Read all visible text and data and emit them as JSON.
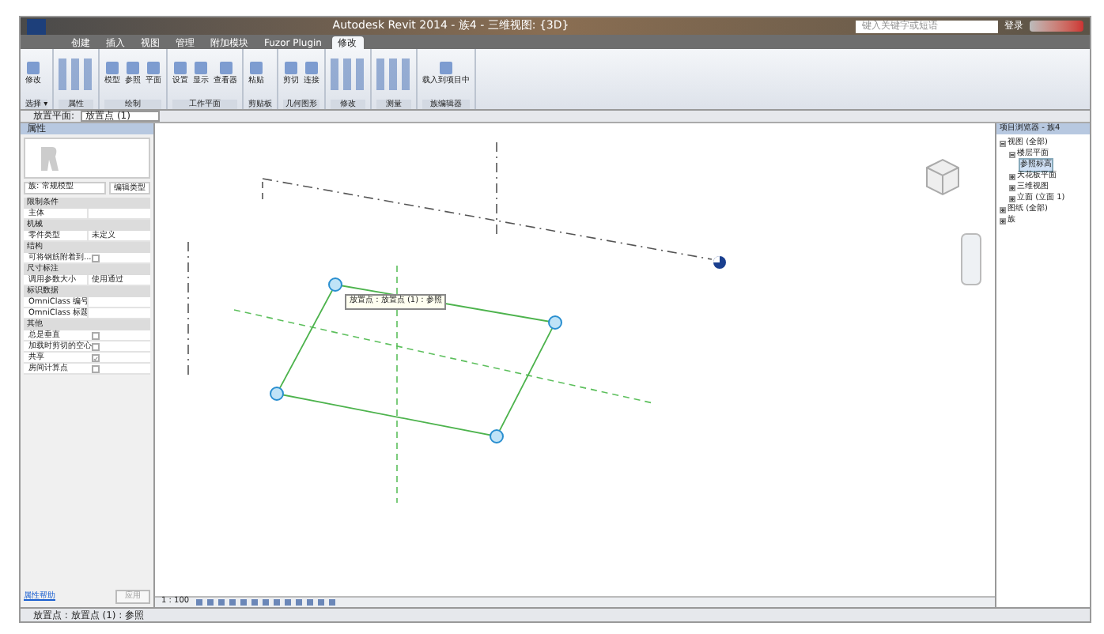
{
  "window": {
    "title": "Autodesk Revit 2014 - 族4 - 三维视图: {3D}"
  },
  "search": {
    "placeholder": "键入关键字或短语"
  },
  "sign_in": "登录",
  "tabs": [
    {
      "label": "创建",
      "selected": false
    },
    {
      "label": "插入",
      "selected": false
    },
    {
      "label": "视图",
      "selected": false
    },
    {
      "label": "管理",
      "selected": false
    },
    {
      "label": "附加模块",
      "selected": false
    },
    {
      "label": "Fuzor Plugin",
      "selected": false
    },
    {
      "label": "修改",
      "selected": true
    }
  ],
  "ribbon_panels": [
    {
      "label": "选择 ▾",
      "buttons": [
        "修改"
      ]
    },
    {
      "label": "属性"
    },
    {
      "label": "绘制",
      "buttons": [
        "模型",
        "参照",
        "平面"
      ]
    },
    {
      "label": "工作平面",
      "buttons": [
        "设置",
        "显示",
        "查看器"
      ]
    },
    {
      "label": "剪贴板",
      "buttons": [
        "粘贴"
      ]
    },
    {
      "label": "几何图形",
      "buttons": [
        "剪切",
        "连接"
      ]
    },
    {
      "label": "修改"
    },
    {
      "label": "测量"
    },
    {
      "label": "族编辑器",
      "buttons": [
        "载入到项目中"
      ]
    }
  ],
  "options_bar": {
    "label": "放置平面:",
    "value": "放置点 (1)"
  },
  "properties": {
    "title": "属性",
    "type_selector": "族: 常规模型",
    "edit_type": "编辑类型",
    "groups": [
      {
        "name": "限制条件",
        "rows": [
          {
            "kind": "text",
            "label": "主体",
            "value": ""
          }
        ]
      },
      {
        "name": "机械",
        "rows": [
          {
            "kind": "text",
            "label": "零件类型",
            "value": "未定义"
          }
        ]
      },
      {
        "name": "结构",
        "rows": [
          {
            "kind": "check",
            "label": "可将钢筋附着到...",
            "checked": false
          }
        ]
      },
      {
        "name": "尺寸标注",
        "rows": [
          {
            "kind": "text",
            "label": "调用参数大小",
            "value": "使用通过"
          }
        ]
      },
      {
        "name": "标识数据",
        "rows": [
          {
            "kind": "text",
            "label": "OmniClass 编号",
            "value": ""
          },
          {
            "kind": "text",
            "label": "OmniClass 标题",
            "value": ""
          }
        ]
      },
      {
        "name": "其他",
        "rows": [
          {
            "kind": "check",
            "label": "总是垂直",
            "checked": false
          },
          {
            "kind": "check",
            "label": "加载时剪切的空心",
            "checked": false
          },
          {
            "kind": "check",
            "label": "共享",
            "checked": true
          },
          {
            "kind": "check",
            "label": "房间计算点",
            "checked": false
          }
        ]
      }
    ],
    "help_link": "属性帮助",
    "apply": "应用"
  },
  "canvas": {
    "tooltip": "放置点 : 放置点 (1) : 参照"
  },
  "view_scale": "1 : 100",
  "project_browser": {
    "title": "项目浏览器 - 族4",
    "tree": [
      {
        "label": "视图 (全部)",
        "expanded": true,
        "selected": false,
        "children": [
          {
            "label": "楼层平面",
            "expanded": true,
            "selected": false,
            "children": [
              {
                "label": "参照标高",
                "selected": true
              }
            ]
          },
          {
            "label": "天花板平面",
            "expanded": false,
            "selected": false
          },
          {
            "label": "三维视图",
            "expanded": false,
            "selected": false
          },
          {
            "label": "立面 (立面 1)",
            "expanded": false,
            "selected": false
          }
        ]
      },
      {
        "label": "图纸 (全部)",
        "expanded": false,
        "selected": false
      },
      {
        "label": "族",
        "expanded": false,
        "selected": false
      }
    ]
  },
  "status_bar": "放置点 : 放置点 (1) : 参照"
}
